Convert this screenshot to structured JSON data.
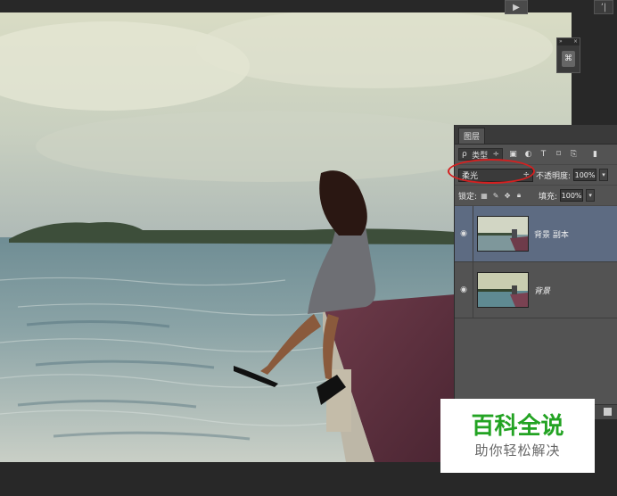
{
  "top_buttons": {
    "play_icon": "▶",
    "corner_icon": "ʼ|"
  },
  "mini_panel": {
    "collapse_icon": "»",
    "close_icon": "×",
    "tool_icon": "⌘"
  },
  "layers_panel": {
    "tab_label": "图层",
    "filter": {
      "value": "类型",
      "search_icon": "ρ",
      "arrow": "÷"
    },
    "filter_icons": [
      "image-filter-icon",
      "adjustment-filter-icon",
      "type-filter-icon",
      "shape-filter-icon",
      "smart-object-filter-icon"
    ],
    "blend_mode": {
      "value": "柔光",
      "arrow": "÷"
    },
    "opacity": {
      "label": "不透明度:",
      "value": "100%",
      "arrow": "▾"
    },
    "lock": {
      "label": "锁定:"
    },
    "fill": {
      "label": "填充:",
      "value": "100%",
      "arrow": "▾"
    },
    "layers": [
      {
        "name": "背景 副本",
        "selected": true
      },
      {
        "name": "背景",
        "selected": false
      }
    ]
  },
  "watermark": {
    "title": "百科全说",
    "subtitle": "助你轻松解决"
  },
  "colors": {
    "panel_bg": "#535353",
    "selected_layer": "#5d6b82",
    "highlight_ring": "#d42020",
    "watermark_green": "#23a323"
  }
}
